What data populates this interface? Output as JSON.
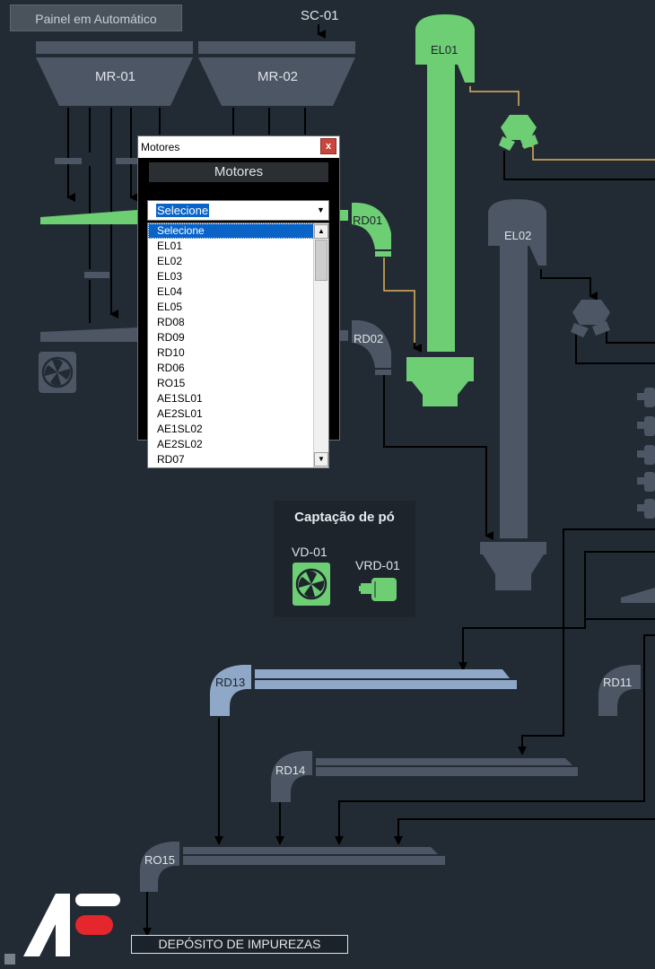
{
  "header": {
    "auto_button": "Painel em Automático"
  },
  "labels": {
    "sc01": "SC-01",
    "mr01": "MR-01",
    "mr02": "MR-02",
    "el01": "EL01",
    "el02": "EL02",
    "rd01": "RD01",
    "rd02": "RD02",
    "rd13": "RD13",
    "rd11": "RD11",
    "rd14": "RD14",
    "ro15": "RO15"
  },
  "captacao": {
    "title": "Captação de pó",
    "vd01": "VD-01",
    "vrd01": "VRD-01"
  },
  "deposito": "DEPÓSITO DE IMPUREZAS",
  "motores_dialog": {
    "window_title": "Motores",
    "close": "x",
    "header": "Motores",
    "selected": "Selecione",
    "options": [
      "Selecione",
      "EL01",
      "EL02",
      "EL03",
      "EL04",
      "EL05",
      "RD08",
      "RD09",
      "RD10",
      "RD06",
      "RO15",
      "AE1SL01",
      "AE2SL01",
      "AE1SL02",
      "AE2SL02",
      "RD07"
    ]
  },
  "colors": {
    "active": "#6dce74",
    "inactive": "#4c5664",
    "selected_blue": "#8fa8c8",
    "signal": "#e0b25a",
    "background": "#222b34"
  }
}
